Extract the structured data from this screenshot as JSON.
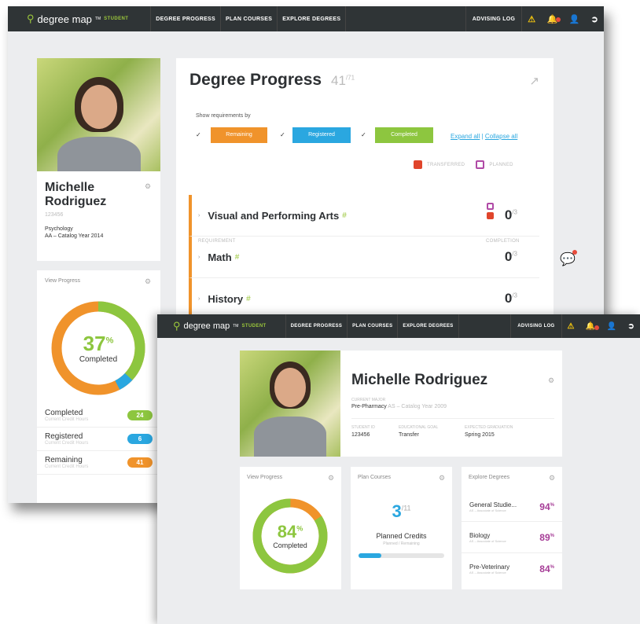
{
  "nav": {
    "logo": "degree map",
    "tm": "TM",
    "student": "STUDENT",
    "links": [
      "DEGREE PROGRESS",
      "PLAN COURSES",
      "EXPLORE DEGREES"
    ],
    "advising": "ADVISING LOG"
  },
  "w1": {
    "profile": {
      "name": "Michelle Rodriguez",
      "id": "123456",
      "major": "Psychology",
      "catalog": "AA – Catalog Year 2014"
    },
    "progress": {
      "title": "View Progress",
      "percent": "37",
      "pct_sign": "%",
      "label": "Completed",
      "completed_frac": 0.37,
      "registered_frac": 0.054,
      "rows": [
        {
          "label": "Completed",
          "sub": "Current Credit Hours",
          "value": "24",
          "color": "#8dc63f"
        },
        {
          "label": "Registered",
          "sub": "Current Credit Hours",
          "value": "6",
          "color": "#2aa7e0"
        },
        {
          "label": "Remaining",
          "sub": "Current Credit Hours",
          "value": "41",
          "color": "#f0932b"
        }
      ]
    },
    "degree": {
      "title": "Degree Progress",
      "count": "41",
      "total": "/71",
      "show_by": "Show requirements by",
      "filters": [
        {
          "label": "Remaining",
          "color": "#f0932b"
        },
        {
          "label": "Registered",
          "color": "#2aa7e0"
        },
        {
          "label": "Completed",
          "color": "#8dc63f"
        }
      ],
      "expand": "Expand all",
      "sep": " | ",
      "collapse": "Collapse all",
      "legend_transferred": "TRANSFERRED",
      "legend_planned": "PLANNED",
      "col_req": "REQUIREMENT",
      "col_completion": "COMPLETION",
      "requirements": [
        {
          "title": "Visual and Performing Arts",
          "count": "0",
          "total": "/3"
        },
        {
          "title": "Math",
          "count": "0",
          "total": "/3"
        },
        {
          "title": "History",
          "count": "0",
          "total": "/3"
        }
      ]
    }
  },
  "w2": {
    "profile": {
      "name": "Michelle Rodriguez",
      "major_label": "CURRENT MAJOR",
      "major": "Pre-Pharmacy",
      "catalog": "AS – Catalog Year 2009",
      "student_id_label": "STUDENT ID",
      "student_id": "123456",
      "edu_label": "EDUCATIONAL GOAL",
      "edu": "Transfer",
      "grad_label": "EXPECTED GRADUATION",
      "grad": "Spring 2015"
    },
    "progress": {
      "title": "View Progress",
      "percent": "84",
      "pct_sign": "%",
      "label": "Completed",
      "completed_frac": 0.84
    },
    "plan": {
      "title": "Plan Courses",
      "count": "3",
      "total": "/11",
      "label": "Planned Credits",
      "sub": "Planned / Remaining",
      "fill": 0.27
    },
    "explore": {
      "title": "Explore Degrees",
      "items": [
        {
          "label": "General Studie...",
          "sub": "AS – Associate of Science",
          "pct": "94",
          "sign": "%"
        },
        {
          "label": "Biology",
          "sub": "AS – Associate of Science",
          "pct": "89",
          "sign": "%"
        },
        {
          "label": "Pre-Veterinary",
          "sub": "AS – Associate of Science",
          "pct": "84",
          "sign": "%"
        }
      ]
    }
  }
}
